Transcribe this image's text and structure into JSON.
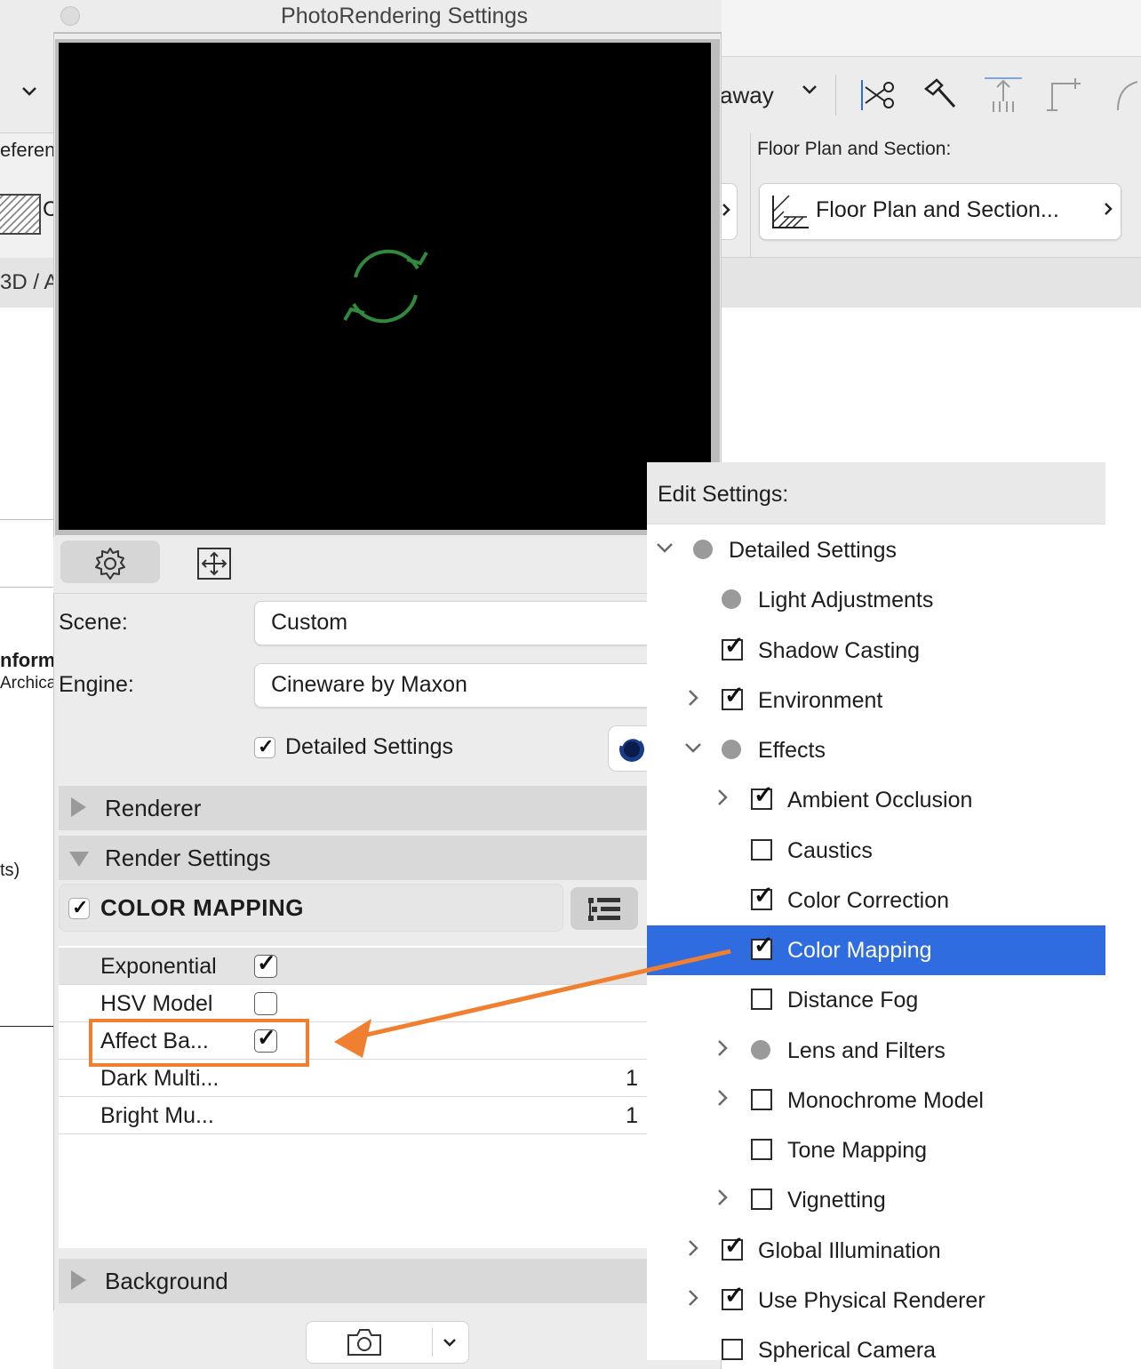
{
  "background_app": {
    "left_toolbar_text": "eferen",
    "left_box_letter": "C",
    "left_breadcrumb": "3D / A",
    "left_inform": "nform",
    "left_archica": "Archica",
    "left_ts": "ts)",
    "toolbar_away": "away",
    "floor_plan_label": "Floor Plan and Section:",
    "floor_plan_button": "Floor Plan and Section..."
  },
  "dialog": {
    "title": "PhotoRendering Settings",
    "scene_label": "Scene:",
    "scene_value": "Custom",
    "engine_label": "Engine:",
    "engine_value": "Cineware by Maxon",
    "detailed_settings_label": "Detailed Settings",
    "detailed_settings_checked": true,
    "sections": {
      "renderer": "Renderer",
      "render_settings": "Render Settings",
      "background": "Background"
    },
    "color_mapping": {
      "title": "COLOR MAPPING",
      "enabled": true,
      "properties": [
        {
          "label": "Exponential",
          "type": "checkbox",
          "checked": true
        },
        {
          "label": "HSV Model",
          "type": "checkbox",
          "checked": false
        },
        {
          "label": "Affect Ba...",
          "type": "checkbox",
          "checked": true
        },
        {
          "label": "Dark Multi...",
          "type": "value",
          "value": "1"
        },
        {
          "label": "Bright Mu...",
          "type": "value",
          "value": "1"
        }
      ]
    }
  },
  "edit_settings": {
    "header": "Edit Settings:",
    "items": [
      {
        "label": "Detailed Settings",
        "level": 0,
        "chevron": "down",
        "state": "mixed"
      },
      {
        "label": "Light Adjustments",
        "level": 1,
        "chevron": "none",
        "state": "mixed"
      },
      {
        "label": "Shadow Casting",
        "level": 1,
        "chevron": "none",
        "state": "checked"
      },
      {
        "label": "Environment",
        "level": 1,
        "chevron": "right",
        "state": "checked"
      },
      {
        "label": "Effects",
        "level": 1,
        "chevron": "down",
        "state": "mixed"
      },
      {
        "label": "Ambient Occlusion",
        "level": 2,
        "chevron": "right",
        "state": "checked"
      },
      {
        "label": "Caustics",
        "level": 2,
        "chevron": "none",
        "state": "unchecked"
      },
      {
        "label": "Color Correction",
        "level": 2,
        "chevron": "none",
        "state": "checked"
      },
      {
        "label": "Color Mapping",
        "level": 2,
        "chevron": "none",
        "state": "checked",
        "selected": true
      },
      {
        "label": "Distance Fog",
        "level": 2,
        "chevron": "none",
        "state": "unchecked"
      },
      {
        "label": "Lens and Filters",
        "level": 2,
        "chevron": "right",
        "state": "mixed"
      },
      {
        "label": "Monochrome Model",
        "level": 2,
        "chevron": "right",
        "state": "unchecked"
      },
      {
        "label": "Tone Mapping",
        "level": 2,
        "chevron": "none",
        "state": "unchecked"
      },
      {
        "label": "Vignetting",
        "level": 2,
        "chevron": "right",
        "state": "unchecked"
      },
      {
        "label": "Global Illumination",
        "level": 1,
        "chevron": "right",
        "state": "checked"
      },
      {
        "label": "Use Physical Renderer",
        "level": 1,
        "chevron": "right",
        "state": "checked"
      },
      {
        "label": "Spherical Camera",
        "level": 1,
        "chevron": "none",
        "state": "unchecked"
      }
    ]
  },
  "colors": {
    "selection": "#2f6ce0",
    "annotation": "#f08030",
    "refresh_icon": "#2f8a3e"
  },
  "icons": [
    "gear-icon",
    "fit-to-window-icon",
    "refresh-icon",
    "list-view-icon",
    "camera-icon",
    "chevron-down-icon",
    "cineware-logo-icon"
  ]
}
